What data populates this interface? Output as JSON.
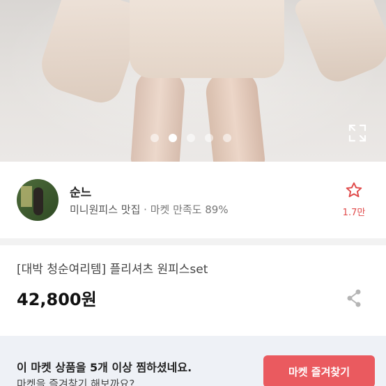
{
  "carousel": {
    "dot_count": 5,
    "active_index": 1
  },
  "seller": {
    "name": "순느",
    "tagline": "미니원피스 맛집",
    "separator": "·",
    "satisfaction": "마켓 만족도 89%",
    "favorite_count": "1.7만",
    "favorite_icon": "star-outline-icon"
  },
  "product": {
    "title": "[대박 청순여리템] 플리셔츠 원피스set",
    "price": "42,800원",
    "share_icon": "share-icon"
  },
  "banner": {
    "line1": "이 마켓 상품을 5개 이상 찜하셨네요.",
    "line2": "마켓을 즐겨찾기 해보까요?",
    "button_label": "마켓 즐겨찾기"
  },
  "colors": {
    "accent": "#ea5a5f",
    "banner_bg": "#eef1f6"
  }
}
